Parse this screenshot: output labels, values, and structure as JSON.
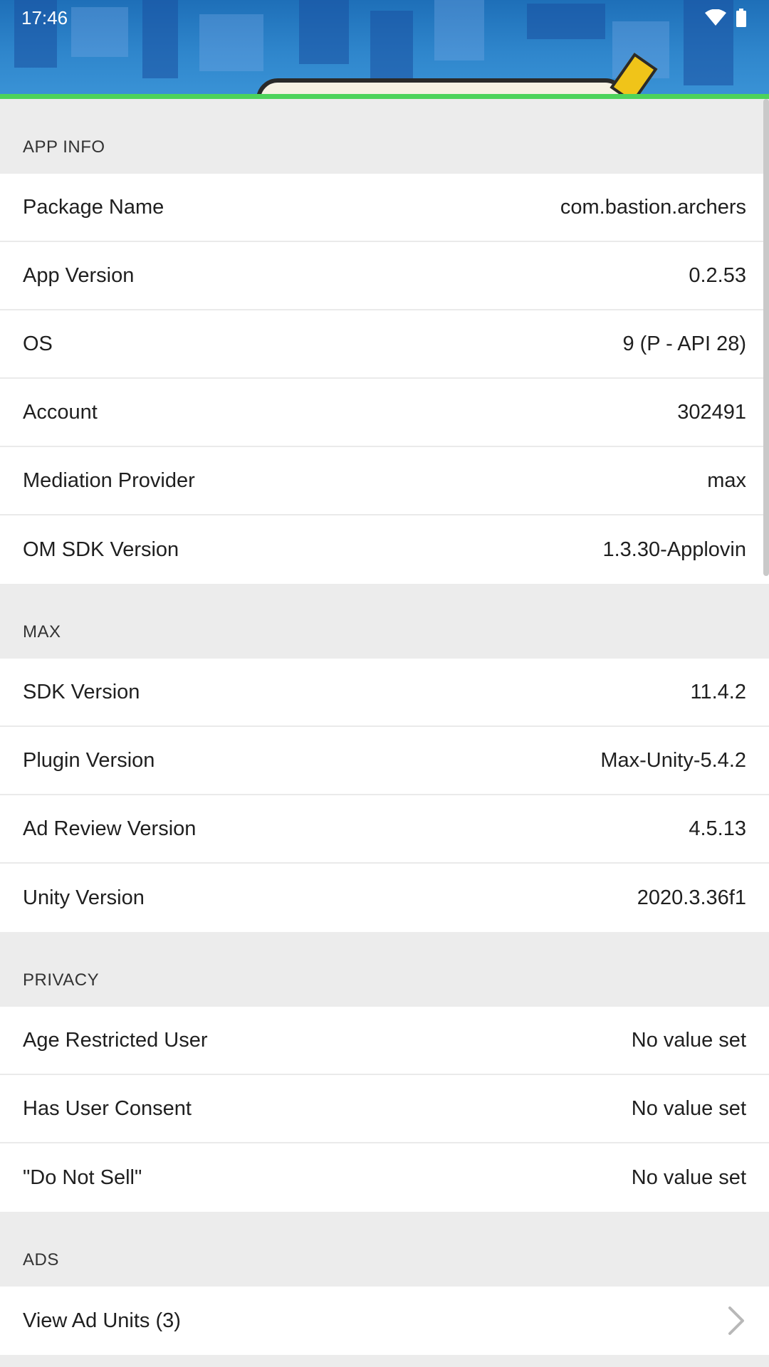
{
  "status_bar": {
    "time": "17:46",
    "wifi_icon": "wifi-icon",
    "battery_icon": "battery-icon"
  },
  "sections": [
    {
      "title": "APP INFO",
      "rows": [
        {
          "label": "Package Name",
          "value": "com.bastion.archers"
        },
        {
          "label": "App Version",
          "value": "0.2.53"
        },
        {
          "label": "OS",
          "value": "9 (P - API 28)"
        },
        {
          "label": "Account",
          "value": "302491"
        },
        {
          "label": "Mediation Provider",
          "value": "max"
        },
        {
          "label": "OM SDK Version",
          "value": "1.3.30-Applovin"
        }
      ]
    },
    {
      "title": "MAX",
      "rows": [
        {
          "label": "SDK Version",
          "value": "11.4.2"
        },
        {
          "label": "Plugin Version",
          "value": "Max-Unity-5.4.2"
        },
        {
          "label": "Ad Review Version",
          "value": "4.5.13"
        },
        {
          "label": "Unity Version",
          "value": "2020.3.36f1"
        }
      ]
    },
    {
      "title": "PRIVACY",
      "rows": [
        {
          "label": "Age Restricted User",
          "value": "No value set"
        },
        {
          "label": "Has User Consent",
          "value": "No value set"
        },
        {
          "label": "\"Do Not Sell\"",
          "value": "No value set"
        }
      ]
    },
    {
      "title": "ADS",
      "rows": [
        {
          "label": "View Ad Units (3)",
          "icon": "chevron-right-icon"
        }
      ]
    }
  ],
  "colors": {
    "accent_line": "#4dd35b",
    "section_bg": "#ececec",
    "row_bg": "#ffffff"
  }
}
